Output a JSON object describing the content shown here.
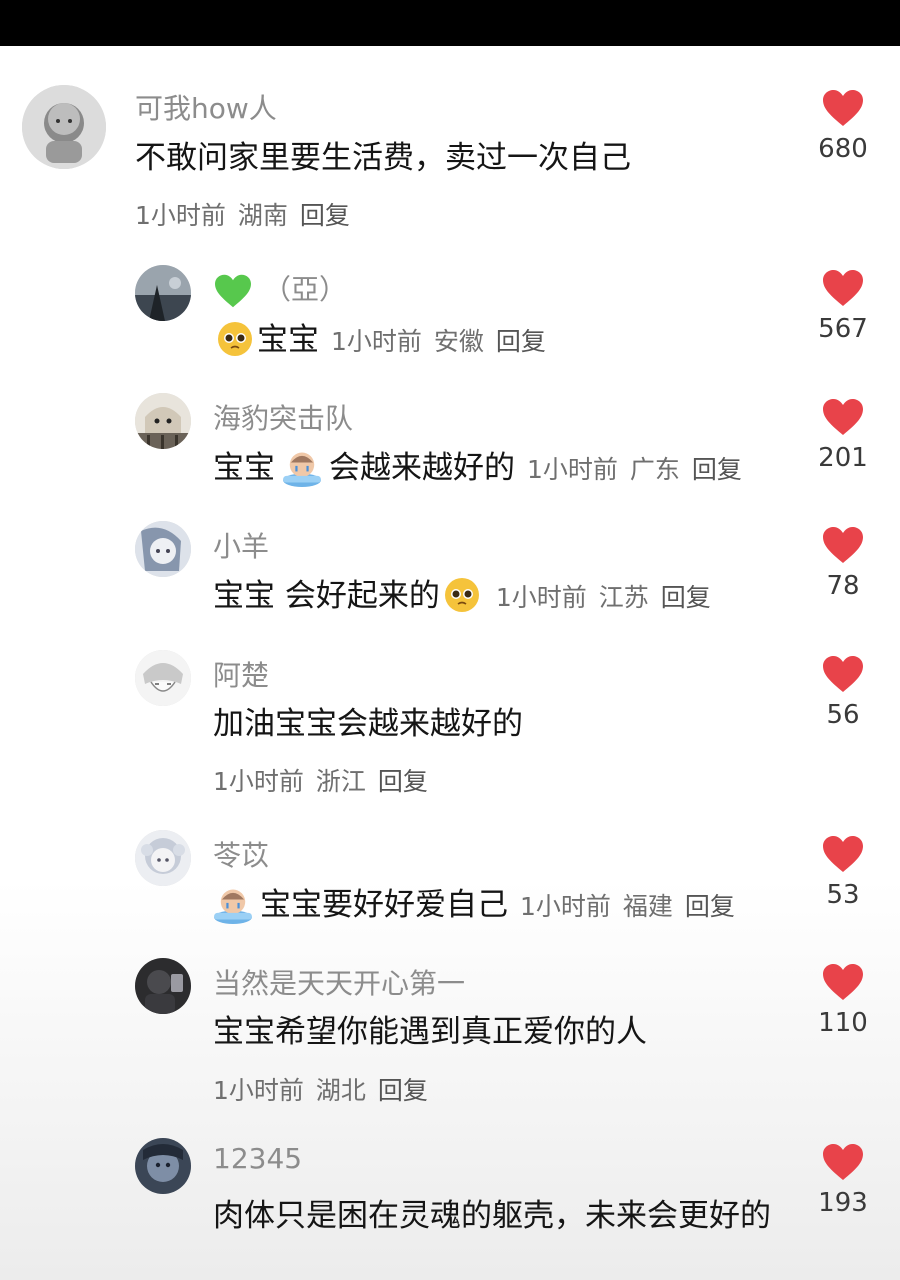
{
  "colors": {
    "heart": "#e8434a",
    "green_heart": "#57c84d",
    "username": "#8c8c8c",
    "meta": "#6f6f6f"
  },
  "comments": [
    {
      "username": "可我how人",
      "text": "不敢问家里要生活费，卖过一次自己",
      "time": "1小时前",
      "location": "湖南",
      "reply": "回复",
      "likes": "680"
    },
    {
      "username": "（亞）",
      "text": "宝宝",
      "time": "1小时前",
      "location": "安徽",
      "reply": "回复",
      "likes": "567"
    },
    {
      "username": "海豹突击队",
      "text_before": "宝宝",
      "text_after": "会越来越好的",
      "time": "1小时前",
      "location": "广东",
      "reply": "回复",
      "likes": "201"
    },
    {
      "username": "小羊",
      "text": "宝宝 会好起来的",
      "time": "1小时前",
      "location": "江苏",
      "reply": "回复",
      "likes": "78"
    },
    {
      "username": "阿楚",
      "text": "加油宝宝会越来越好的",
      "time": "1小时前",
      "location": "浙江",
      "reply": "回复",
      "likes": "56"
    },
    {
      "username": "苓苡",
      "text": "宝宝要好好爱自己",
      "time": "1小时前",
      "location": "福建",
      "reply": "回复",
      "likes": "53"
    },
    {
      "username": "当然是天天开心第一",
      "text": "宝宝希望你能遇到真正爱你的人",
      "time": "1小时前",
      "location": "湖北",
      "reply": "回复",
      "likes": "110"
    },
    {
      "username": "12345",
      "text": "肉体只是困在灵魂的躯壳，未来会更好的",
      "likes": "193"
    }
  ]
}
